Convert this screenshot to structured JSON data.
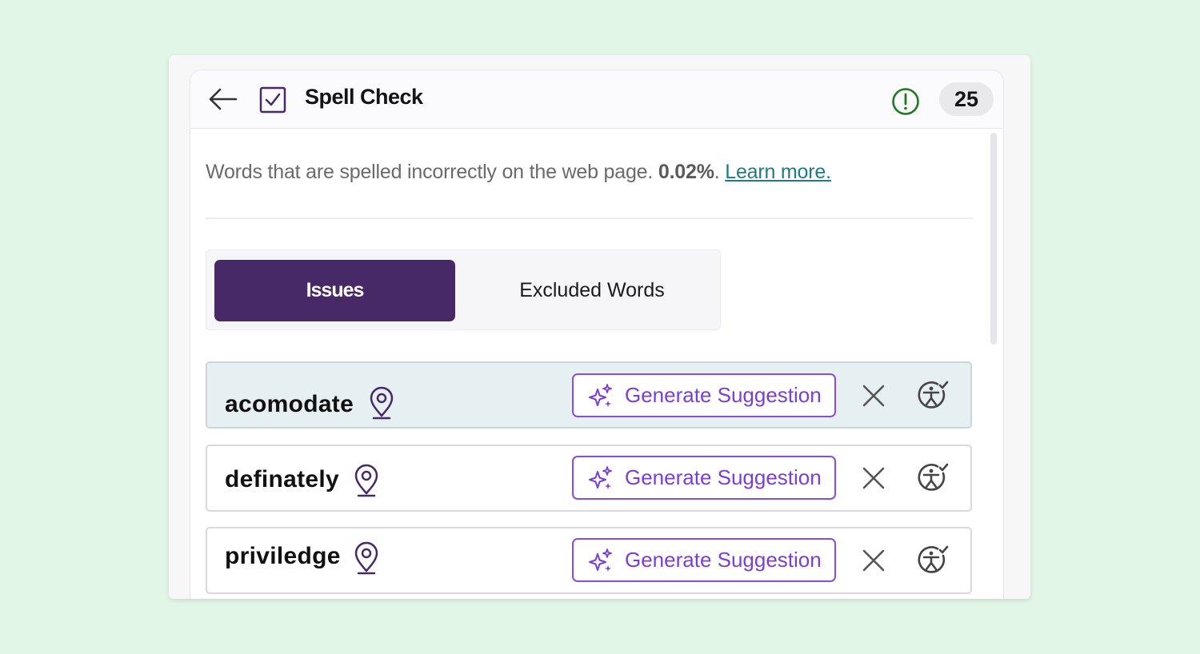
{
  "header": {
    "title": "Spell Check",
    "count": "25",
    "icons": {
      "back": "arrow-left-icon",
      "check": "checkbox-checked-icon",
      "alert": "alert-circle-icon"
    }
  },
  "description": {
    "text": "Words that are spelled incorrectly on the web page.",
    "percent": "0.02%",
    "period": ".",
    "learn_more": "Learn more."
  },
  "tabs": [
    {
      "label": "Issues",
      "active": true
    },
    {
      "label": "Excluded Words",
      "active": false
    }
  ],
  "issues": [
    {
      "word": "acomodate",
      "button": "Generate Suggestion",
      "highlighted": true
    },
    {
      "word": "definately",
      "button": "Generate Suggestion",
      "highlighted": false
    },
    {
      "word": "priviledge",
      "button": "Generate Suggestion",
      "highlighted": false
    }
  ],
  "colors": {
    "background": "#e2f6e7",
    "accent": "#462966",
    "button_border": "#8a4be0",
    "link": "#1e7b86",
    "alert": "#1f7a1f"
  }
}
